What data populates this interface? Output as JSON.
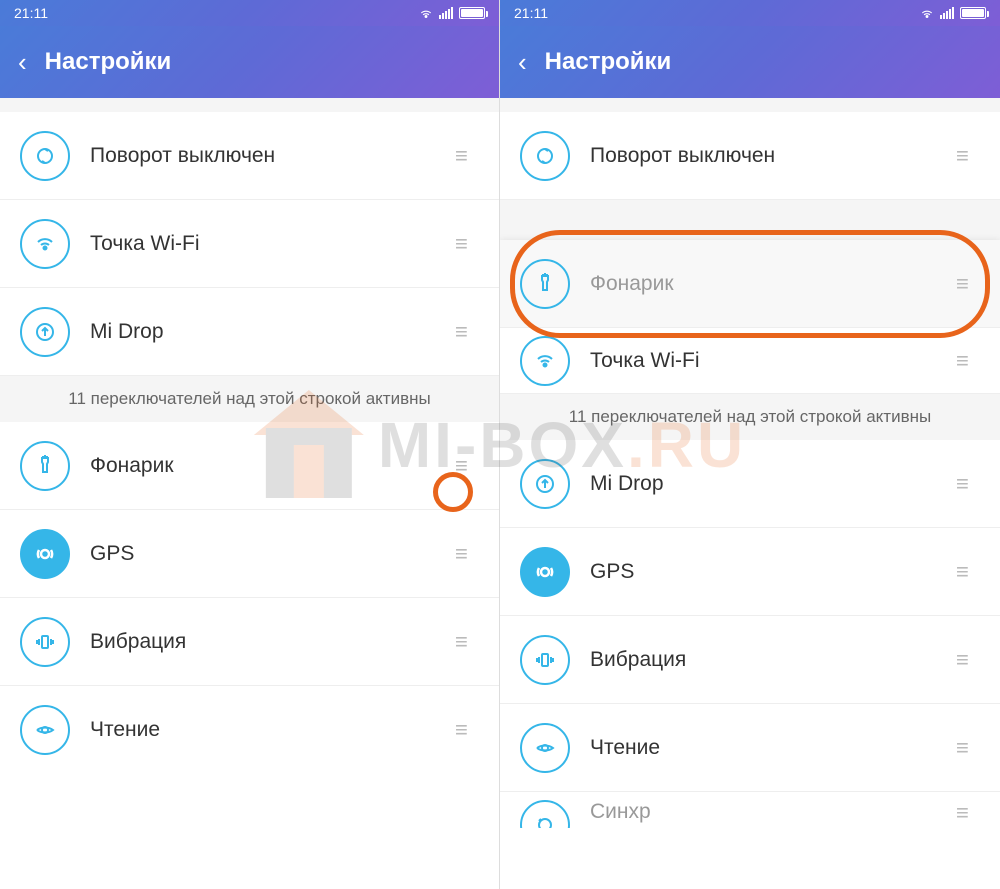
{
  "statusbar": {
    "time": "21:11"
  },
  "header": {
    "title": "Настройки"
  },
  "divider_text": "11 переключателей над этой строкой активны",
  "left": {
    "items_top": [
      {
        "label": "Поворот выключен",
        "icon": "rotation-icon"
      },
      {
        "label": "Точка Wi-Fi",
        "icon": "wifi-hotspot-icon"
      },
      {
        "label": "Mi Drop",
        "icon": "midrop-icon"
      }
    ],
    "items_bottom": [
      {
        "label": "Фонарик",
        "icon": "flashlight-icon"
      },
      {
        "label": "GPS",
        "icon": "gps-icon",
        "filled": true
      },
      {
        "label": "Вибрация",
        "icon": "vibration-icon"
      },
      {
        "label": "Чтение",
        "icon": "reading-icon"
      }
    ]
  },
  "right": {
    "items_top": [
      {
        "label": "Поворот выключен",
        "icon": "rotation-icon"
      },
      {
        "label": "Фонарик",
        "icon": "flashlight-icon",
        "dragging": true
      },
      {
        "label": "Точка Wi-Fi",
        "icon": "wifi-hotspot-icon"
      }
    ],
    "items_bottom": [
      {
        "label": "Mi Drop",
        "icon": "midrop-icon"
      },
      {
        "label": "GPS",
        "icon": "gps-icon",
        "filled": true
      },
      {
        "label": "Вибрация",
        "icon": "vibration-icon"
      },
      {
        "label": "Чтение",
        "icon": "reading-icon"
      },
      {
        "label": "Синхр",
        "icon": "sync-icon",
        "partial": true
      }
    ]
  },
  "watermark": {
    "text_prefix": "MI-BOX",
    "text_suffix": ".RU"
  },
  "colors": {
    "accent": "#35b6e8",
    "highlight": "#e8641b"
  }
}
